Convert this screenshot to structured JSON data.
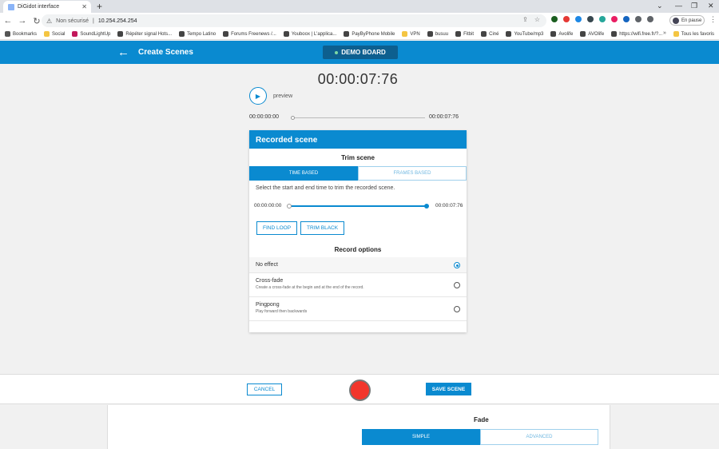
{
  "browser": {
    "tab_title": "DiGidot interface",
    "tab_close": "✕",
    "new_tab": "+",
    "window_controls": [
      "⌄",
      "—",
      "❐",
      "✕"
    ],
    "nav": {
      "back": "←",
      "forward": "→",
      "reload": "↻"
    },
    "omnibox": {
      "warning_icon": "⚠",
      "security_label": "Non sécurisé",
      "separator": "|",
      "url": "10.254.254.254"
    },
    "omni_icons": [
      "⇪",
      "☆"
    ],
    "profile_label": "En pause",
    "menu_icon": "⋮",
    "bookmarks": [
      {
        "label": "Bookmarks",
        "color": "#555555"
      },
      {
        "label": "Social",
        "color": "#f4c542"
      },
      {
        "label": "SoundLightUp",
        "color": "#c2185b"
      },
      {
        "label": "Répéter signal Hots...",
        "color": "#444444"
      },
      {
        "label": "Tempo Latino",
        "color": "#444444"
      },
      {
        "label": "Forums Freenews /...",
        "color": "#444444"
      },
      {
        "label": "Youboox | L'applica...",
        "color": "#444444"
      },
      {
        "label": "PayByPhone Mobile",
        "color": "#444444"
      },
      {
        "label": "VPN",
        "color": "#f4c542"
      },
      {
        "label": "busuu",
        "color": "#444444"
      },
      {
        "label": "Fitbit",
        "color": "#444444"
      },
      {
        "label": "Ciné",
        "color": "#444444"
      },
      {
        "label": "YouTube/mp3",
        "color": "#444444"
      },
      {
        "label": "Avolife",
        "color": "#444444"
      },
      {
        "label": "AVOlife",
        "color": "#444444"
      },
      {
        "label": "https://wifi.free.fr/?...",
        "color": "#444444"
      }
    ],
    "bookmarks_more": "»",
    "all_bookmarks": "Tous les favoris",
    "extension_colors": [
      "#1b5e20",
      "#e53935",
      "#1e88e5",
      "#37474f",
      "#26a69a",
      "#e91e63",
      "#1565c0",
      "#5f6368",
      "#5f6368"
    ]
  },
  "header": {
    "back_icon": "←",
    "title": "Create Scenes",
    "board_label": "DEMO BOARD"
  },
  "player": {
    "timer": "00:00:07:76",
    "preview_label": "preview",
    "start_time": "00:00:00:00",
    "end_time": "00:00:07:76",
    "play_icon": "▶"
  },
  "recorded_scene": {
    "title": "Recorded scene",
    "trim_title": "Trim scene",
    "tabs": [
      {
        "label": "TIME BASED",
        "active": true
      },
      {
        "label": "FRAMES BASED",
        "active": false
      }
    ],
    "trim_description": "Select the start and end time to trim the recorded scene.",
    "trim_start": "00:00:00:00",
    "trim_end": "00:00:07:76",
    "buttons": [
      "FIND LOOP",
      "TRIM BLACK"
    ],
    "record_options_title": "Record options",
    "options": [
      {
        "name": "No effect",
        "description": "",
        "selected": true
      },
      {
        "name": "Cross-fade",
        "description": "Create a cross-fade at the begin and at the end of the record.",
        "selected": false
      },
      {
        "name": "Pingpong",
        "description": "Play forward then backwards",
        "selected": false
      }
    ]
  },
  "actions": {
    "cancel_label": "CANCEL",
    "save_label": "SAVE SCENE"
  },
  "fade_panel": {
    "title": "Fade",
    "tabs": [
      {
        "label": "SIMPLE",
        "active": true
      },
      {
        "label": "ADVANCED",
        "active": false
      }
    ]
  },
  "colors": {
    "accent": "#0a8ad0",
    "record": "#f2362c"
  }
}
